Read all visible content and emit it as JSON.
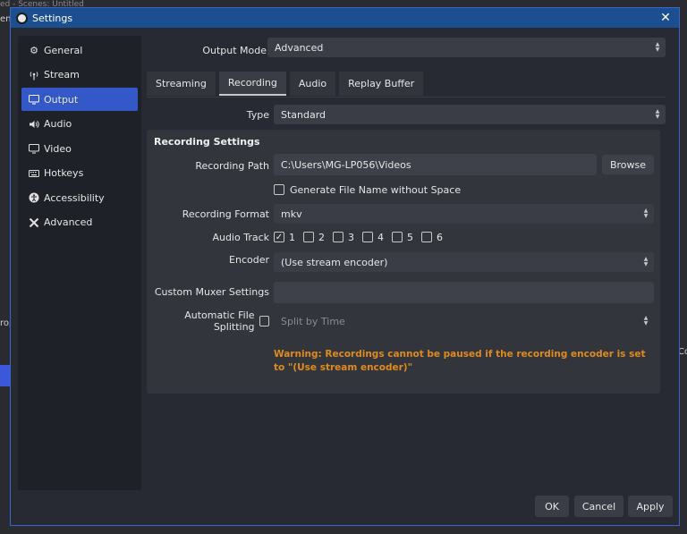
{
  "background": {
    "title_fragment": "ed - Scenes: Untitled",
    "side_fragment_left": "rop",
    "side_fragment_right": "Co",
    "side_fragment_top": "en"
  },
  "window": {
    "title": "Settings"
  },
  "sidebar": {
    "items": [
      {
        "label": "General",
        "icon": "gear-icon",
        "active": false
      },
      {
        "label": "Stream",
        "icon": "antenna-icon",
        "active": false
      },
      {
        "label": "Output",
        "icon": "monitor-output-icon",
        "active": true
      },
      {
        "label": "Audio",
        "icon": "speaker-icon",
        "active": false
      },
      {
        "label": "Video",
        "icon": "display-icon",
        "active": false
      },
      {
        "label": "Hotkeys",
        "icon": "keyboard-icon",
        "active": false
      },
      {
        "label": "Accessibility",
        "icon": "accessibility-icon",
        "active": false
      },
      {
        "label": "Advanced",
        "icon": "tools-icon",
        "active": false
      }
    ]
  },
  "output_mode": {
    "label": "Output Mode",
    "value": "Advanced"
  },
  "tabs": [
    {
      "label": "Streaming",
      "active": false
    },
    {
      "label": "Recording",
      "active": true
    },
    {
      "label": "Audio",
      "active": false
    },
    {
      "label": "Replay Buffer",
      "active": false
    }
  ],
  "type": {
    "label": "Type",
    "value": "Standard"
  },
  "recording_settings": {
    "title": "Recording Settings",
    "path_label": "Recording Path",
    "path_value": "C:\\Users\\MG-LP056\\Videos",
    "browse_label": "Browse",
    "no_space_label": "Generate File Name without Space",
    "no_space_checked": false,
    "format_label": "Recording Format",
    "format_value": "mkv",
    "audio_track_label": "Audio Track",
    "tracks": [
      {
        "num": "1",
        "checked": true
      },
      {
        "num": "2",
        "checked": false
      },
      {
        "num": "3",
        "checked": false
      },
      {
        "num": "4",
        "checked": false
      },
      {
        "num": "5",
        "checked": false
      },
      {
        "num": "6",
        "checked": false
      }
    ],
    "encoder_label": "Encoder",
    "encoder_value": "(Use stream encoder)",
    "muxer_label": "Custom Muxer Settings",
    "muxer_value": "",
    "splitting_label": "Automatic File Splitting",
    "splitting_checked": false,
    "splitting_value": "Split by Time",
    "warning": "Warning: Recordings cannot be paused if the recording encoder is set to \"(Use stream encoder)\""
  },
  "footer": {
    "ok": "OK",
    "cancel": "Cancel",
    "apply": "Apply"
  },
  "colors": {
    "accent": "#3558c9",
    "titlebar": "#1c4f8f",
    "warning": "#e08a1c"
  }
}
